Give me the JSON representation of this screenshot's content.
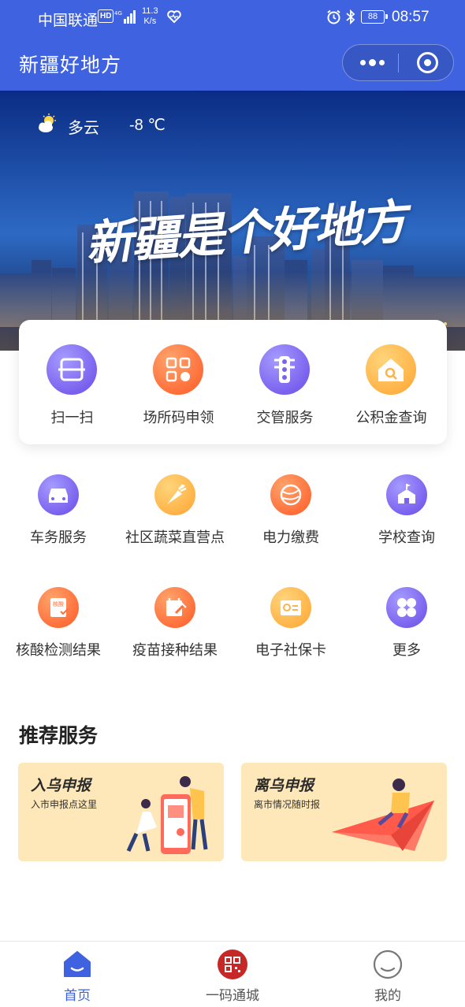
{
  "status_bar": {
    "carrier": "中国联通",
    "hd": "HD",
    "net_speed_value": "11.3",
    "net_speed_unit": "K/s",
    "battery": "88",
    "time": "08:57"
  },
  "nav": {
    "title": "新疆好地方"
  },
  "banner": {
    "weather_condition": "多云",
    "temperature": "-8 ℃",
    "slogan": "新疆是个好地方"
  },
  "quick_access": [
    {
      "label": "扫一扫",
      "icon": "scan-icon",
      "color": "#7b62ee"
    },
    {
      "label": "场所码申领",
      "icon": "qrcode-apply-icon",
      "color": "#ff6f3a"
    },
    {
      "label": "交管服务",
      "icon": "traffic-light-icon",
      "color": "#7b62ee"
    },
    {
      "label": "公积金查询",
      "icon": "house-search-icon",
      "color": "#ffb347"
    }
  ],
  "services": [
    {
      "label": "车务服务",
      "icon": "car-icon",
      "color": "#7b62ee"
    },
    {
      "label": "社区蔬菜直营点",
      "icon": "carrot-icon",
      "color": "#ffb347"
    },
    {
      "label": "电力缴费",
      "icon": "power-icon",
      "color": "#ff6f3a"
    },
    {
      "label": "学校查询",
      "icon": "school-icon",
      "color": "#7b62ee"
    },
    {
      "label": "核酸检测结果",
      "icon": "test-report-icon",
      "color": "#ff6f3a"
    },
    {
      "label": "疫苗接种结果",
      "icon": "vaccine-icon",
      "color": "#ff6f3a"
    },
    {
      "label": "电子社保卡",
      "icon": "social-card-icon",
      "color": "#ffb347"
    },
    {
      "label": "更多",
      "icon": "more-icon",
      "color": "#7b62ee"
    }
  ],
  "recommended": {
    "title": "推荐服务",
    "cards": [
      {
        "title": "入乌申报",
        "subtitle": "入市申报点这里"
      },
      {
        "title": "离乌申报",
        "subtitle": "离市情况随时报"
      }
    ]
  },
  "tabbar": [
    {
      "label": "首页",
      "icon": "home-icon",
      "active": true
    },
    {
      "label": "一码通城",
      "icon": "qrcode-city-icon",
      "active": false
    },
    {
      "label": "我的",
      "icon": "profile-icon",
      "active": false
    }
  ],
  "colors": {
    "primary": "#3f63e0",
    "card_bg": "#fee8b9"
  }
}
